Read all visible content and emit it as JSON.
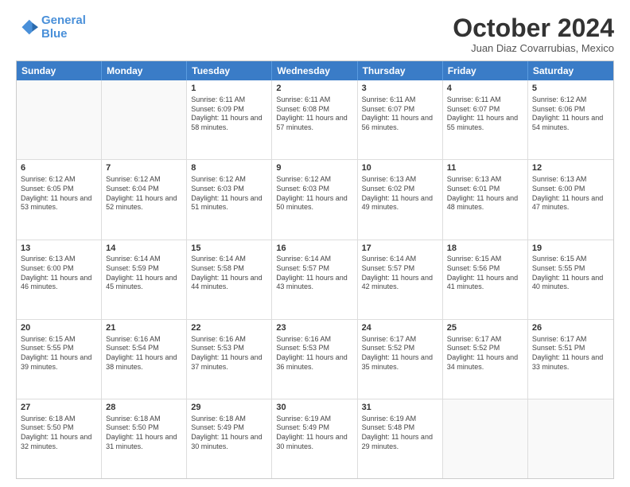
{
  "header": {
    "logo_line1": "General",
    "logo_line2": "Blue",
    "month_title": "October 2024",
    "location": "Juan Diaz Covarrubias, Mexico"
  },
  "days_of_week": [
    "Sunday",
    "Monday",
    "Tuesday",
    "Wednesday",
    "Thursday",
    "Friday",
    "Saturday"
  ],
  "weeks": [
    [
      {
        "day": "",
        "info": ""
      },
      {
        "day": "",
        "info": ""
      },
      {
        "day": "1",
        "info": "Sunrise: 6:11 AM\nSunset: 6:09 PM\nDaylight: 11 hours and 58 minutes."
      },
      {
        "day": "2",
        "info": "Sunrise: 6:11 AM\nSunset: 6:08 PM\nDaylight: 11 hours and 57 minutes."
      },
      {
        "day": "3",
        "info": "Sunrise: 6:11 AM\nSunset: 6:07 PM\nDaylight: 11 hours and 56 minutes."
      },
      {
        "day": "4",
        "info": "Sunrise: 6:11 AM\nSunset: 6:07 PM\nDaylight: 11 hours and 55 minutes."
      },
      {
        "day": "5",
        "info": "Sunrise: 6:12 AM\nSunset: 6:06 PM\nDaylight: 11 hours and 54 minutes."
      }
    ],
    [
      {
        "day": "6",
        "info": "Sunrise: 6:12 AM\nSunset: 6:05 PM\nDaylight: 11 hours and 53 minutes."
      },
      {
        "day": "7",
        "info": "Sunrise: 6:12 AM\nSunset: 6:04 PM\nDaylight: 11 hours and 52 minutes."
      },
      {
        "day": "8",
        "info": "Sunrise: 6:12 AM\nSunset: 6:03 PM\nDaylight: 11 hours and 51 minutes."
      },
      {
        "day": "9",
        "info": "Sunrise: 6:12 AM\nSunset: 6:03 PM\nDaylight: 11 hours and 50 minutes."
      },
      {
        "day": "10",
        "info": "Sunrise: 6:13 AM\nSunset: 6:02 PM\nDaylight: 11 hours and 49 minutes."
      },
      {
        "day": "11",
        "info": "Sunrise: 6:13 AM\nSunset: 6:01 PM\nDaylight: 11 hours and 48 minutes."
      },
      {
        "day": "12",
        "info": "Sunrise: 6:13 AM\nSunset: 6:00 PM\nDaylight: 11 hours and 47 minutes."
      }
    ],
    [
      {
        "day": "13",
        "info": "Sunrise: 6:13 AM\nSunset: 6:00 PM\nDaylight: 11 hours and 46 minutes."
      },
      {
        "day": "14",
        "info": "Sunrise: 6:14 AM\nSunset: 5:59 PM\nDaylight: 11 hours and 45 minutes."
      },
      {
        "day": "15",
        "info": "Sunrise: 6:14 AM\nSunset: 5:58 PM\nDaylight: 11 hours and 44 minutes."
      },
      {
        "day": "16",
        "info": "Sunrise: 6:14 AM\nSunset: 5:57 PM\nDaylight: 11 hours and 43 minutes."
      },
      {
        "day": "17",
        "info": "Sunrise: 6:14 AM\nSunset: 5:57 PM\nDaylight: 11 hours and 42 minutes."
      },
      {
        "day": "18",
        "info": "Sunrise: 6:15 AM\nSunset: 5:56 PM\nDaylight: 11 hours and 41 minutes."
      },
      {
        "day": "19",
        "info": "Sunrise: 6:15 AM\nSunset: 5:55 PM\nDaylight: 11 hours and 40 minutes."
      }
    ],
    [
      {
        "day": "20",
        "info": "Sunrise: 6:15 AM\nSunset: 5:55 PM\nDaylight: 11 hours and 39 minutes."
      },
      {
        "day": "21",
        "info": "Sunrise: 6:16 AM\nSunset: 5:54 PM\nDaylight: 11 hours and 38 minutes."
      },
      {
        "day": "22",
        "info": "Sunrise: 6:16 AM\nSunset: 5:53 PM\nDaylight: 11 hours and 37 minutes."
      },
      {
        "day": "23",
        "info": "Sunrise: 6:16 AM\nSunset: 5:53 PM\nDaylight: 11 hours and 36 minutes."
      },
      {
        "day": "24",
        "info": "Sunrise: 6:17 AM\nSunset: 5:52 PM\nDaylight: 11 hours and 35 minutes."
      },
      {
        "day": "25",
        "info": "Sunrise: 6:17 AM\nSunset: 5:52 PM\nDaylight: 11 hours and 34 minutes."
      },
      {
        "day": "26",
        "info": "Sunrise: 6:17 AM\nSunset: 5:51 PM\nDaylight: 11 hours and 33 minutes."
      }
    ],
    [
      {
        "day": "27",
        "info": "Sunrise: 6:18 AM\nSunset: 5:50 PM\nDaylight: 11 hours and 32 minutes."
      },
      {
        "day": "28",
        "info": "Sunrise: 6:18 AM\nSunset: 5:50 PM\nDaylight: 11 hours and 31 minutes."
      },
      {
        "day": "29",
        "info": "Sunrise: 6:18 AM\nSunset: 5:49 PM\nDaylight: 11 hours and 30 minutes."
      },
      {
        "day": "30",
        "info": "Sunrise: 6:19 AM\nSunset: 5:49 PM\nDaylight: 11 hours and 30 minutes."
      },
      {
        "day": "31",
        "info": "Sunrise: 6:19 AM\nSunset: 5:48 PM\nDaylight: 11 hours and 29 minutes."
      },
      {
        "day": "",
        "info": ""
      },
      {
        "day": "",
        "info": ""
      }
    ]
  ]
}
